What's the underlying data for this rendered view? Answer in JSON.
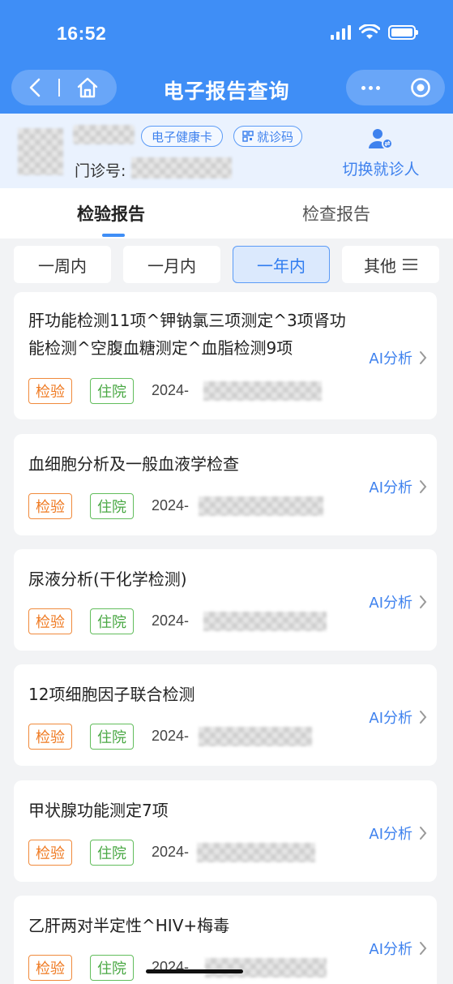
{
  "status_bar": {
    "time": "16:52"
  },
  "nav": {
    "title": "电子报告查询"
  },
  "patient": {
    "health_card_label": "电子健康卡",
    "visit_code_label": "就诊码",
    "clinic_no_label": "门诊号:",
    "switch_label": "切换就诊人"
  },
  "tabs": [
    {
      "label": "检验报告",
      "active": true
    },
    {
      "label": "检查报告",
      "active": false
    }
  ],
  "filters": [
    {
      "label": "一周内",
      "active": false
    },
    {
      "label": "一月内",
      "active": false
    },
    {
      "label": "一年内",
      "active": true
    },
    {
      "label": "其他",
      "active": false
    }
  ],
  "reports": [
    {
      "title": "肝功能检测11项^钾钠氯三项测定^3项肾功能检测^空腹血糖测定^血脂检测9项",
      "type": "检验",
      "dept": "住院",
      "date_prefix": "2024-",
      "ai_label": "AI分析"
    },
    {
      "title": "血细胞分析及一般血液学检查",
      "type": "检验",
      "dept": "住院",
      "date_prefix": "2024-",
      "ai_label": "AI分析"
    },
    {
      "title": "尿液分析(干化学检测)",
      "type": "检验",
      "dept": "住院",
      "date_prefix": "2024-",
      "ai_label": "AI分析"
    },
    {
      "title": "12项细胞因子联合检测",
      "type": "检验",
      "dept": "住院",
      "date_prefix": "2024-",
      "ai_label": "AI分析"
    },
    {
      "title": "甲状腺功能测定7项",
      "type": "检验",
      "dept": "住院",
      "date_prefix": "2024-",
      "ai_label": "AI分析"
    },
    {
      "title": "乙肝两对半定性^HIV+梅毒",
      "type": "检验",
      "dept": "住院",
      "date_prefix": "2024-",
      "ai_label": "AI分析"
    }
  ],
  "colors": {
    "primary": "#3f8ef6",
    "badge_type": "#ef7a22",
    "badge_dept": "#4aa844"
  }
}
